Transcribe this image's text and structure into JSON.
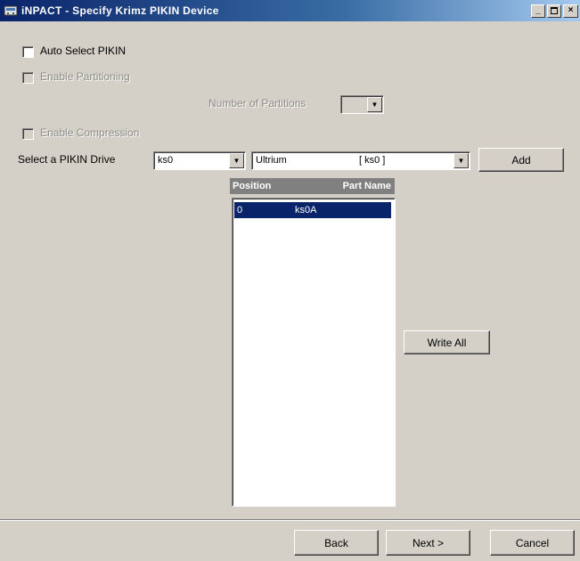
{
  "window": {
    "title": "iNPACT  -  Specify Krimz PIKIN Device"
  },
  "options": {
    "auto_select_label": "Auto Select PIKIN",
    "enable_partitioning_label": "Enable Partitioning",
    "number_of_partitions_label": "Number of Partitions",
    "number_of_partitions_value": "",
    "enable_compression_label": "Enable Compression"
  },
  "select_row": {
    "label": "Select a PIKIN Drive",
    "drive_value": "ks0",
    "type_value": "Ultrium",
    "type_suffix": "[ ks0 ]",
    "add_label": "Add"
  },
  "list": {
    "columns": [
      "Position",
      "Part Name"
    ],
    "rows": [
      {
        "position": "0",
        "part_name": "ks0A"
      }
    ]
  },
  "write_all_label": "Write All",
  "footer": {
    "back_label": "Back",
    "next_label": "Next >",
    "cancel_label": "Cancel"
  },
  "colors": {
    "title_bar_start": "#0a246a",
    "title_bar_end": "#a6caf0",
    "selection": "#0a246a",
    "dialog_face": "#d4d0c8"
  }
}
